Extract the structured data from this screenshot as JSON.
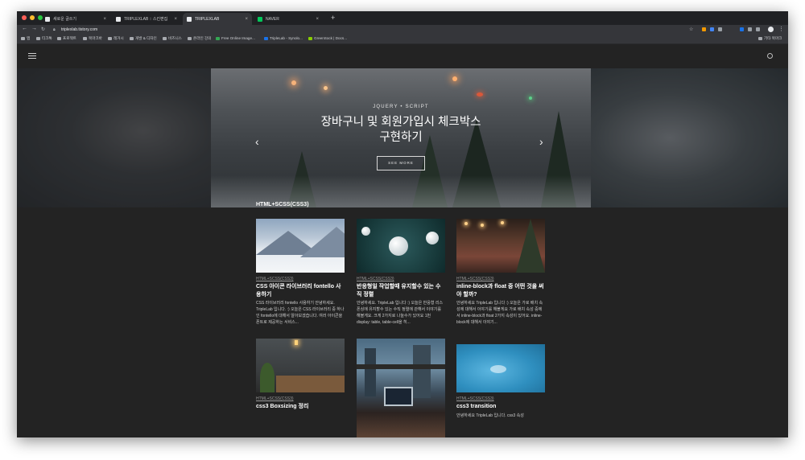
{
  "tabs": [
    {
      "title": "새로운 글쓰기",
      "favicon_color": "#e8eaed"
    },
    {
      "title": "TRIPLEXLAB :: 스킨편집",
      "favicon_color": "#e8eaed"
    },
    {
      "title": "TRIPLEXLAB",
      "favicon_color": "#e8eaed",
      "active": true
    },
    {
      "title": "NAVER",
      "favicon_color": "#03c75a"
    }
  ],
  "address": {
    "url": "triplexlab.tistory.com"
  },
  "bookmarks": [
    "앱",
    "티크톡",
    "프로젝트",
    "북마크바",
    "레거시",
    "개발 & 디자인",
    "비즈니스",
    "온라인 강의",
    "Free Online Image...",
    "TripleLab - Synolo...",
    "GreenSock | Docs...",
    "기타 북마크"
  ],
  "hero": {
    "category": "JQUERY • SCRIPT",
    "title_line1": "장바구니 및 회원가입시 체크박스",
    "title_line2": "구현하기",
    "button": "SEE MORE",
    "prev": "‹",
    "next": "›"
  },
  "section": {
    "title": "HTML+SCSS(CSS3)"
  },
  "cards": [
    {
      "category": "HTML+SCSS(CSS3)",
      "title": "CSS 아이콘 라이브러리 fontello 사용하기",
      "excerpt": "CSS 라이브러리 fontello 사용하기 안녕하세요. TripleLab 입니다. :) 오늘은 CSS 라이브러리 중 하나인 fontello에 대해서 알아보겠습니다. 여러 아이콘을 폰트로 제공하는 서비스..."
    },
    {
      "category": "HTML+SCSS(CSS3)",
      "title": "반응형일 작업할때 유지할수 있는 수직 정렬",
      "excerpt": "안녕하세요. TripleLab 입니다 :) 오늘은 반응형 리스폰싱에 유지할수 있는 수직 정렬에 관해서 이야기를 해볼게요. 크게 2가지로 나눌수가 있어요 1번 display: table, table-cell을 히..."
    },
    {
      "category": "HTML+SCSS(CSS3)",
      "title": "inline-block과 float 중 어떤 것을 써야 할까?",
      "excerpt": "안녕하세요 TripleLab 입니다 :) 오늘은 가로 배치 속성에 대해서 이야기를 해볼게요 가로 배치 속성 중에서 inline-block과 float 2가지 속성이 있어요. inline-block에 대해서 이야기..."
    },
    {
      "category": "HTML+SCSS(CSS3)",
      "title": "css3 Boxsizing 정리",
      "excerpt": ""
    },
    {
      "category": "",
      "title": "",
      "excerpt": ""
    },
    {
      "category": "HTML+SCSS(CSS3)",
      "title": "css3 transition",
      "excerpt": "안녕하세요 TripleLab 입니다. css3 속성"
    }
  ]
}
